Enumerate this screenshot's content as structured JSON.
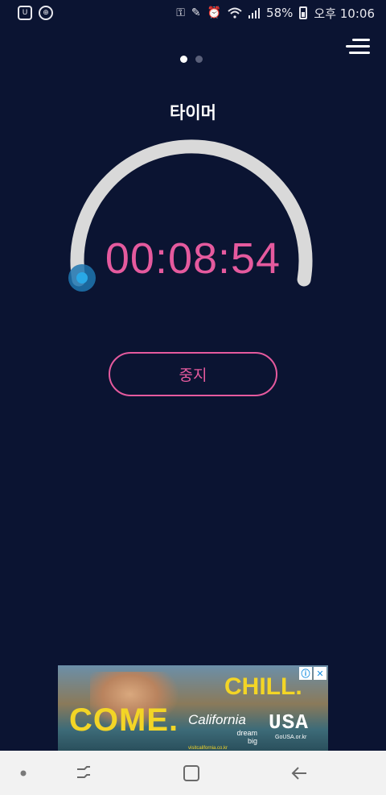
{
  "status_bar": {
    "battery_percent": "58%",
    "time": "오후 10:06",
    "left_icons": [
      "lock-app-icon",
      "game-controller-icon"
    ],
    "right_icons": [
      "battery-saver-icon",
      "pen-icon",
      "alarm-icon",
      "wifi-icon",
      "signal-icon",
      "battery-icon"
    ]
  },
  "pager": {
    "total": 2,
    "active": 0
  },
  "timer": {
    "title": "타이머",
    "time": "00:08:54",
    "stop_label": "중지",
    "progress": 0.0
  },
  "colors": {
    "background": "#0b1432",
    "accent": "#e55a9e",
    "dial_track": "#d9d9d9",
    "knob": "#29a8e6"
  },
  "ad": {
    "headline_left": "COME.",
    "headline_right": "CHILL.",
    "brand": "California",
    "tagline_1": "dream",
    "tagline_2": "big",
    "brand_url": "visitcalifornia.co.kr",
    "partner": "USA",
    "partner_url": "GoUSA.or.kr",
    "info_icon": "ⓘ",
    "close_icon": "✕"
  },
  "nav_bar": {
    "items": [
      "dot-icon",
      "recent-apps-icon",
      "home-icon",
      "back-icon"
    ]
  }
}
